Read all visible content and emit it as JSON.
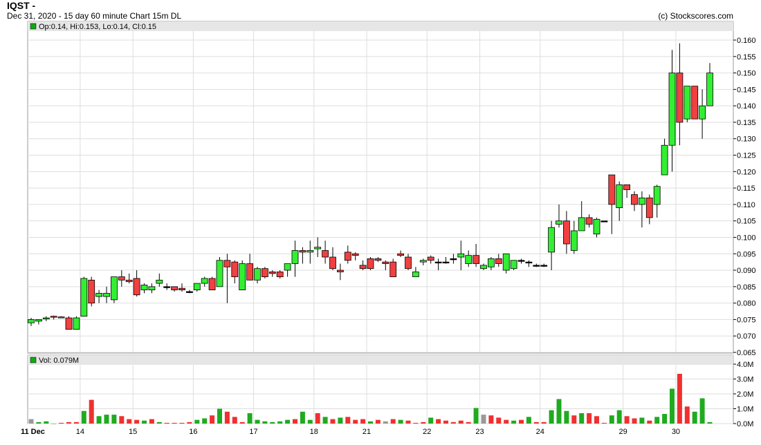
{
  "header": {
    "symbol": "IQST -",
    "subtitle": "Dec 31, 2020 - 15 day 60 minute Chart 15m DL",
    "copyright": "(c) Stockscores.com"
  },
  "price_panel": {
    "legend": "Op:0.14, Hi:0.153, Lo:0.14, Cl:0.15"
  },
  "volume_panel": {
    "legend": "Vol: 0.079M"
  },
  "colors": {
    "up": "#33ee33",
    "down": "#f04040",
    "flat": "#999999",
    "vol_up": "#20aa20",
    "vol_down": "#f03030",
    "vol_flat": "#999999",
    "legend_marker": "#11aa11",
    "grid": "#dddddd",
    "legend_bg": "#e6e6e6"
  },
  "chart_data": [
    {
      "type": "candlestick",
      "title": "Op:0.14, Hi:0.153, Lo:0.14, Cl:0.15",
      "ylim": [
        0.065,
        0.16
      ],
      "y_ticks": [
        "0.065",
        "0.070",
        "0.075",
        "0.080",
        "0.085",
        "0.090",
        "0.095",
        "0.100",
        "0.105",
        "0.110",
        "0.115",
        "0.120",
        "0.125",
        "0.130",
        "0.135",
        "0.140",
        "0.145",
        "0.150",
        "0.155",
        "0.160"
      ],
      "x_labels": [
        "11 Dec",
        "14",
        "15",
        "16",
        "17",
        "18",
        "21",
        "22",
        "23",
        "24",
        "29",
        "30"
      ],
      "grid": true,
      "candles": [
        {
          "o": 0.074,
          "h": 0.0755,
          "l": 0.073,
          "c": 0.075
        },
        {
          "o": 0.0745,
          "h": 0.075,
          "l": 0.0735,
          "c": 0.075
        },
        {
          "o": 0.0752,
          "h": 0.076,
          "l": 0.0745,
          "c": 0.0755
        },
        {
          "o": 0.076,
          "h": 0.0762,
          "l": 0.075,
          "c": 0.0758
        },
        {
          "o": 0.0758,
          "h": 0.076,
          "l": 0.0755,
          "c": 0.0755
        },
        {
          "o": 0.0755,
          "h": 0.076,
          "l": 0.072,
          "c": 0.072
        },
        {
          "o": 0.072,
          "h": 0.076,
          "l": 0.072,
          "c": 0.0755
        },
        {
          "o": 0.076,
          "h": 0.088,
          "l": 0.076,
          "c": 0.0875
        },
        {
          "o": 0.087,
          "h": 0.088,
          "l": 0.079,
          "c": 0.08
        },
        {
          "o": 0.082,
          "h": 0.084,
          "l": 0.08,
          "c": 0.083
        },
        {
          "o": 0.082,
          "h": 0.085,
          "l": 0.08,
          "c": 0.083
        },
        {
          "o": 0.081,
          "h": 0.088,
          "l": 0.08,
          "c": 0.088
        },
        {
          "o": 0.088,
          "h": 0.09,
          "l": 0.085,
          "c": 0.087
        },
        {
          "o": 0.087,
          "h": 0.089,
          "l": 0.086,
          "c": 0.0865
        },
        {
          "o": 0.0875,
          "h": 0.09,
          "l": 0.082,
          "c": 0.0825
        },
        {
          "o": 0.084,
          "h": 0.086,
          "l": 0.083,
          "c": 0.0855
        },
        {
          "o": 0.084,
          "h": 0.086,
          "l": 0.083,
          "c": 0.085
        },
        {
          "o": 0.086,
          "h": 0.089,
          "l": 0.085,
          "c": 0.087
        },
        {
          "o": 0.085,
          "h": 0.086,
          "l": 0.084,
          "c": 0.085
        },
        {
          "o": 0.085,
          "h": 0.085,
          "l": 0.0835,
          "c": 0.084
        },
        {
          "o": 0.0845,
          "h": 0.086,
          "l": 0.0835,
          "c": 0.084
        },
        {
          "o": 0.0835,
          "h": 0.084,
          "l": 0.083,
          "c": 0.0835
        },
        {
          "o": 0.084,
          "h": 0.086,
          "l": 0.0835,
          "c": 0.086
        },
        {
          "o": 0.086,
          "h": 0.088,
          "l": 0.085,
          "c": 0.0875
        },
        {
          "o": 0.0875,
          "h": 0.088,
          "l": 0.084,
          "c": 0.084
        },
        {
          "o": 0.085,
          "h": 0.094,
          "l": 0.085,
          "c": 0.093
        },
        {
          "o": 0.093,
          "h": 0.095,
          "l": 0.08,
          "c": 0.091
        },
        {
          "o": 0.0925,
          "h": 0.093,
          "l": 0.086,
          "c": 0.088
        },
        {
          "o": 0.084,
          "h": 0.093,
          "l": 0.084,
          "c": 0.092
        },
        {
          "o": 0.092,
          "h": 0.095,
          "l": 0.088,
          "c": 0.087
        },
        {
          "o": 0.087,
          "h": 0.091,
          "l": 0.086,
          "c": 0.0905
        },
        {
          "o": 0.0905,
          "h": 0.091,
          "l": 0.0875,
          "c": 0.088
        },
        {
          "o": 0.0895,
          "h": 0.09,
          "l": 0.088,
          "c": 0.089
        },
        {
          "o": 0.0895,
          "h": 0.09,
          "l": 0.0875,
          "c": 0.088
        },
        {
          "o": 0.09,
          "h": 0.092,
          "l": 0.088,
          "c": 0.092
        },
        {
          "o": 0.092,
          "h": 0.099,
          "l": 0.088,
          "c": 0.096
        },
        {
          "o": 0.096,
          "h": 0.097,
          "l": 0.092,
          "c": 0.0955
        },
        {
          "o": 0.0955,
          "h": 0.099,
          "l": 0.092,
          "c": 0.096
        },
        {
          "o": 0.0965,
          "h": 0.1,
          "l": 0.094,
          "c": 0.097
        },
        {
          "o": 0.096,
          "h": 0.099,
          "l": 0.092,
          "c": 0.094
        },
        {
          "o": 0.094,
          "h": 0.097,
          "l": 0.09,
          "c": 0.0905
        },
        {
          "o": 0.09,
          "h": 0.092,
          "l": 0.087,
          "c": 0.0895
        },
        {
          "o": 0.0955,
          "h": 0.0975,
          "l": 0.092,
          "c": 0.093
        },
        {
          "o": 0.095,
          "h": 0.0955,
          "l": 0.093,
          "c": 0.0945
        },
        {
          "o": 0.0915,
          "h": 0.093,
          "l": 0.09,
          "c": 0.0905
        },
        {
          "o": 0.0935,
          "h": 0.094,
          "l": 0.09,
          "c": 0.0905
        },
        {
          "o": 0.0935,
          "h": 0.094,
          "l": 0.0925,
          "c": 0.093
        },
        {
          "o": 0.0925,
          "h": 0.093,
          "l": 0.09,
          "c": 0.092
        },
        {
          "o": 0.0925,
          "h": 0.0935,
          "l": 0.088,
          "c": 0.088
        },
        {
          "o": 0.095,
          "h": 0.096,
          "l": 0.094,
          "c": 0.0945
        },
        {
          "o": 0.094,
          "h": 0.095,
          "l": 0.09,
          "c": 0.0905
        },
        {
          "o": 0.088,
          "h": 0.091,
          "l": 0.088,
          "c": 0.0895
        },
        {
          "o": 0.0925,
          "h": 0.0935,
          "l": 0.0915,
          "c": 0.093
        },
        {
          "o": 0.094,
          "h": 0.0945,
          "l": 0.092,
          "c": 0.093
        },
        {
          "o": 0.0925,
          "h": 0.0935,
          "l": 0.09,
          "c": 0.0925
        },
        {
          "o": 0.0925,
          "h": 0.094,
          "l": 0.092,
          "c": 0.0925
        },
        {
          "o": 0.0935,
          "h": 0.095,
          "l": 0.092,
          "c": 0.0935
        },
        {
          "o": 0.094,
          "h": 0.099,
          "l": 0.09,
          "c": 0.095
        },
        {
          "o": 0.092,
          "h": 0.096,
          "l": 0.091,
          "c": 0.0945
        },
        {
          "o": 0.0945,
          "h": 0.098,
          "l": 0.091,
          "c": 0.092
        },
        {
          "o": 0.0905,
          "h": 0.092,
          "l": 0.09,
          "c": 0.0915
        },
        {
          "o": 0.091,
          "h": 0.094,
          "l": 0.09,
          "c": 0.0935
        },
        {
          "o": 0.0935,
          "h": 0.095,
          "l": 0.091,
          "c": 0.092
        },
        {
          "o": 0.09,
          "h": 0.095,
          "l": 0.089,
          "c": 0.095
        },
        {
          "o": 0.0905,
          "h": 0.093,
          "l": 0.09,
          "c": 0.093
        },
        {
          "o": 0.093,
          "h": 0.0935,
          "l": 0.092,
          "c": 0.093
        },
        {
          "o": 0.0925,
          "h": 0.093,
          "l": 0.091,
          "c": 0.0925
        },
        {
          "o": 0.0915,
          "h": 0.092,
          "l": 0.091,
          "c": 0.0915
        },
        {
          "o": 0.0915,
          "h": 0.092,
          "l": 0.091,
          "c": 0.0915
        },
        {
          "o": 0.0955,
          "h": 0.105,
          "l": 0.09,
          "c": 0.103
        },
        {
          "o": 0.104,
          "h": 0.11,
          "l": 0.103,
          "c": 0.105
        },
        {
          "o": 0.105,
          "h": 0.108,
          "l": 0.095,
          "c": 0.098
        },
        {
          "o": 0.096,
          "h": 0.105,
          "l": 0.095,
          "c": 0.102
        },
        {
          "o": 0.102,
          "h": 0.111,
          "l": 0.102,
          "c": 0.106
        },
        {
          "o": 0.106,
          "h": 0.107,
          "l": 0.103,
          "c": 0.104
        },
        {
          "o": 0.101,
          "h": 0.106,
          "l": 0.1,
          "c": 0.1055
        },
        {
          "o": 0.105,
          "h": 0.105,
          "l": 0.105,
          "c": 0.105
        },
        {
          "o": 0.119,
          "h": 0.119,
          "l": 0.101,
          "c": 0.11
        },
        {
          "o": 0.109,
          "h": 0.117,
          "l": 0.105,
          "c": 0.116
        },
        {
          "o": 0.116,
          "h": 0.116,
          "l": 0.112,
          "c": 0.1145
        },
        {
          "o": 0.113,
          "h": 0.114,
          "l": 0.108,
          "c": 0.11
        },
        {
          "o": 0.11,
          "h": 0.114,
          "l": 0.103,
          "c": 0.112
        },
        {
          "o": 0.112,
          "h": 0.113,
          "l": 0.104,
          "c": 0.106
        },
        {
          "o": 0.11,
          "h": 0.116,
          "l": 0.106,
          "c": 0.1155
        },
        {
          "o": 0.119,
          "h": 0.13,
          "l": 0.119,
          "c": 0.128
        },
        {
          "o": 0.128,
          "h": 0.157,
          "l": 0.12,
          "c": 0.15
        },
        {
          "o": 0.15,
          "h": 0.159,
          "l": 0.128,
          "c": 0.135
        },
        {
          "o": 0.136,
          "h": 0.146,
          "l": 0.135,
          "c": 0.146
        },
        {
          "o": 0.146,
          "h": 0.146,
          "l": 0.136,
          "c": 0.136
        },
        {
          "o": 0.136,
          "h": 0.145,
          "l": 0.13,
          "c": 0.14
        },
        {
          "o": 0.14,
          "h": 0.153,
          "l": 0.14,
          "c": 0.15
        }
      ]
    },
    {
      "type": "bar",
      "title": "Vol: 0.079M",
      "ylim": [
        0,
        4
      ],
      "y_ticks": [
        "0.0M",
        "1.0M",
        "2.0M",
        "3.0M",
        "4.0M"
      ],
      "ylabel": "",
      "values": [
        0.3,
        0.1,
        0.15,
        0.0,
        0.05,
        0.1,
        0.1,
        0.85,
        1.6,
        0.5,
        0.6,
        0.6,
        0.5,
        0.3,
        0.25,
        0.2,
        0.3,
        0.1,
        0.05,
        0.05,
        0.05,
        0.1,
        0.25,
        0.35,
        0.55,
        1.0,
        0.8,
        0.45,
        0.1,
        0.7,
        0.25,
        0.15,
        0.1,
        0.15,
        0.25,
        0.3,
        0.8,
        0.25,
        0.7,
        0.45,
        0.3,
        0.4,
        0.45,
        0.25,
        0.3,
        0.15,
        0.25,
        0.15,
        0.3,
        0.25,
        0.2,
        0.05,
        0.1,
        0.4,
        0.3,
        0.2,
        0.1,
        0.2,
        0.1,
        1.05,
        0.6,
        0.55,
        0.4,
        0.25,
        0.2,
        0.25,
        0.45,
        0.1,
        0.1,
        0.9,
        1.65,
        0.85,
        0.55,
        0.7,
        0.7,
        0.5,
        0.05,
        0.55,
        0.9,
        0.5,
        0.35,
        0.4,
        0.2,
        0.45,
        0.65,
        2.35,
        3.35,
        1.15,
        0.8,
        1.7,
        0.1
      ],
      "colors": [
        "f",
        "u",
        "u",
        "u",
        "d",
        "d",
        "d",
        "u",
        "d",
        "u",
        "u",
        "u",
        "d",
        "d",
        "d",
        "u",
        "d",
        "u",
        "d",
        "d",
        "d",
        "d",
        "u",
        "u",
        "d",
        "u",
        "d",
        "d",
        "d",
        "u",
        "u",
        "u",
        "u",
        "u",
        "u",
        "d",
        "u",
        "u",
        "d",
        "u",
        "d",
        "u",
        "d",
        "d",
        "d",
        "u",
        "d",
        "f",
        "d",
        "u",
        "d",
        "d",
        "d",
        "u",
        "d",
        "d",
        "d",
        "d",
        "d",
        "u",
        "f",
        "d",
        "d",
        "d",
        "u",
        "d",
        "u",
        "d",
        "d",
        "u",
        "u",
        "u",
        "d",
        "u",
        "d",
        "d",
        "d",
        "u",
        "u",
        "d",
        "d",
        "u",
        "d",
        "u",
        "u",
        "u",
        "d",
        "d",
        "u",
        "u",
        "u"
      ]
    }
  ]
}
